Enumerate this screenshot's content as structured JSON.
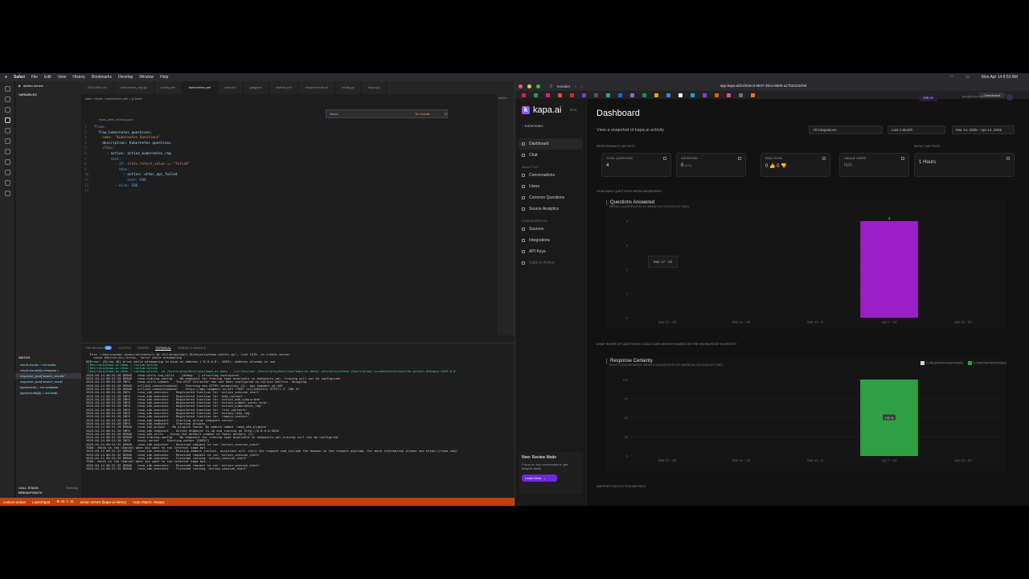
{
  "menubar": {
    "app": "Safari",
    "items": [
      "File",
      "Edit",
      "View",
      "History",
      "Bookmarks",
      "Develop",
      "Window",
      "Help"
    ],
    "clock": "Mon Apr 14 8:53 AM"
  },
  "vscode": {
    "run_config": "action server",
    "variables_header": "VARIABLES",
    "watch_header": "WATCH",
    "watch_items": [
      "result.results = not availa..",
      "result.results[0].metadata =",
      "response_json[\"search_results\"",
      "response_json[\"search_result",
      "type(result) = not available",
      "type(results[0]) = not avail.."
    ],
    "call_stack": "CALL STACK",
    "call_stack_state": "Running",
    "breakpoints": "BREAKPOINTS",
    "tabs": [
      "flows_yaml_schema.json",
      "README.md",
      "kubernetes_rag.py",
      "config.yml",
      "kubernetes.yml",
      "rasa.md",
      "gitignore",
      "shared.yml",
      "requirements.txt",
      "config.py",
      "kapa.py"
    ],
    "active_tab": "kubernetes.yml",
    "breadcrumb": "data > flows > kubernetes.yml > {} flows",
    "schema_hint": "flows_yaml_schema.json",
    "find_query": "Jason",
    "find_result": "No results",
    "code": [
      "flows:",
      "  flow_kubernetes_questions:",
      "    name: \"Kubernetes Questions\"",
      "    description: Kubernetes questions",
      "    steps:",
      "      - action: action_kubernetes_rag",
      "        next:",
      "          - if: slots.return_value == \"failed\"",
      "            then:",
      "              - action: utter_api_failed",
      "                next: END",
      "          - else: END",
      ""
    ],
    "panel_tabs": [
      "PROBLEMS",
      "OUTPUT",
      "PORTS",
      "TERMINAL",
      "DEBUG CONSOLE"
    ],
    "problems_count": "64",
    "active_panel_tab": "TERMINAL",
    "outline_label": "action",
    "terminal": [
      "  File \"/Users/greg/.pyenv/versions/3.10.13/lib/python3.10/asyncio/base_events.py\", line 1519, in create_server",
      "    raise OSError(err.errno, 'error while attempting '",
      "OSError: [Errno 48] error while attempting to bind on address ('0.0.0.0', 5055): address already in use",
      "~/Dev/rasa/kapa-ai-demo | custom-action",
      "~/Dev/rasa/kapa-ai-demo | custom-action",
      "~/Dev/rasa/kapa-ai-demo | custom-action  cd /Users/greg/Dev/rasa/kapa-ai-demo ; /usr/bin/env /Users/greg/Dev/rasa/kapa-ai-demo/.venv/bin/python /Users/greg/.vscode/extensions/ms-python.debugpy-2025.6.0-",
      "2025-04-14 08:51:20 DEBUG   rasa.utils.log_utils  - [debug   ] structlog.configured",
      "2025-04-14 08:51:20 DEBUG   rasa.tracing.config  - No endpoint for tracing type available in endpoints.yml, tracing will not be configured.",
      "2025-04-14 08:51:20 INFO    rasa.utils.common  - The OTLP Collector has not been configured to collect metrics. Skipping.",
      "2025-04-14 08:51:20 DEBUG   urllib3.connectionpool  - Starting new HTTPS connection (1): api.segment.io:443",
      "2025-04-14 08:51:20 DEBUG   urllib3.connectionpool  - https://api.segment.io:443 \"POST /v1/identify HTTP/1.1\" 200 21",
      "2025-04-14 08:51:20 INFO    rasa_sdk.executor  - Registered function for 'action_session_start'.",
      "2025-04-14 08:51:20 INFO    rasa_sdk.executor  - Registered function for 'add_contact'.",
      "2025-04-14 08:51:20 INFO    rasa_sdk.executor  - Registered function for 'action_add_subscriber'.",
      "2025-04-14 08:51:20 INFO    rasa_sdk.executor  - Registered function for 'action_submit_sales_form'.",
      "2025-04-14 08:51:20 INFO    rasa_sdk.executor  - Registered function for 'action_kubernetes_rag'.",
      "2025-04-14 08:51:20 INFO    rasa_sdk.executor  - Registered function for 'list_contacts'.",
      "2025-04-14 08:51:20 INFO    rasa_sdk.executor  - Registered function for 'action_rasa_rag'.",
      "2025-04-14 08:51:20 INFO    rasa_sdk.executor  - Registered function for 'remove_contact'.",
      "2025-04-14 08:51:20 INFO    rasa_sdk.endpoint  - Starting action endpoint server...",
      "2025-04-14 08:51:20 INFO    rasa_sdk.endpoint  - Starting plugins...",
      "2025-04-14 08:51:20 DEBUG   rasa_sdk.plugin  - No plugins found: No module named 'rasa_sdk_plugins'",
      "2025-04-14 08:51:20 INFO    rasa_sdk.endpoint  - Action endpoint is up and running on http://0.0.0.0:5055",
      "2025-04-14 08:51:20 DEBUG   rasa_sdk.utils  - Using the default number of Sanic workers (1).",
      "2025-04-14 08:51:20 DEBUG   rasa.tracing.config  - No endpoint for tracing type available in endpoints.yml,tracing will not be configured.",
      "2025-04-14 08:51:20 INFO    sanic.server  - Starting worker [58557]",
      "2025-04-14 08:51:32 DEBUG   rasa_sdk.executor  - Received request to run 'action_session_start'",
      "TODO: check on the channel when you want to run internal kapa bot...",
      "2025-04-14 08:51:32 DEBUG   rasa_sdk.executor  - Missing domain context, assistant will retry the request and include the domain in the request payload. For more information please see https://rasa.com/",
      "2025-04-14 08:51:32 DEBUG   rasa_sdk.executor  - Received request to run 'action_session_start'",
      "2025-04-14 08:51:32 DEBUG   rasa_sdk.executor  - Finished running 'action_session_start'",
      "TODO: check on the channel when you want to run internal kapa bot...",
      "2025-04-14 08:51:32 DEBUG   rasa_sdk.executor  - Received request to run 'action_session_start'",
      "2025-04-14 08:51:32 DEBUG   rasa_sdk.executor  - Finished running 'action_session_start'"
    ],
    "status": [
      "custom-action",
      "Launchpad",
      "43",
      "11",
      "action server (kapa-ai-demo)",
      "Auto Attach: Always"
    ]
  },
  "browser": {
    "profile": "Snooker",
    "url": "app.kapa.ai/b1f23ecd-5847-4bca-8608-a17b2d13cf6d",
    "active_tab": "Dashboard",
    "fav_colors": [
      "#e11d48",
      "#16a34a",
      "#db2777",
      "#ef4444",
      "#dc2626",
      "#7c3aed",
      "#4b5563",
      "#10b981",
      "#2563eb",
      "#a855f7",
      "#059669",
      "#f59e0b",
      "#3b82f6",
      "#ffffff",
      "#0ea5e9",
      "#9333ea",
      "#ea580c",
      "#ec4899",
      "#6b7280",
      "#f97316"
    ]
  },
  "kapa": {
    "logo": "kapa.ai",
    "beta": "BETA",
    "project": "Kubernetes",
    "nav": [
      {
        "label": "Dashboard",
        "active": true
      },
      {
        "label": "Chat",
        "active": false
      }
    ],
    "analytics_header": "ANALYTICS",
    "analytics": [
      "Conversations",
      "Users",
      "Common Questions",
      "Source Analytics"
    ],
    "config_header": "CONFIGURATION",
    "config": [
      "Sources",
      "Integrations",
      "API Keys",
      "Calls to Action"
    ],
    "promo": {
      "title": "New: Review Mode",
      "text": "Focus on key conversations, get insights faster",
      "button": "Learn More →"
    },
    "ask_ai": "Ask AI",
    "user": "greg@rasa.com",
    "title": "Dashboard",
    "subtitle": "View a snapshot of kapa.ai activity",
    "filter_integrations": "All integrations",
    "filter_range": "Last 1 Month",
    "filter_dates": "Mar 14, 2025 – Apr 14, 2025",
    "perf_label": "PERFORMANCE METRICS",
    "impact_label": "IMPACT METRICS",
    "cards": [
      {
        "label": "TOTAL QUESTIONS",
        "value": "4"
      },
      {
        "label": "UNCERTAIN",
        "value": "0",
        "extra": "(0%)"
      },
      {
        "label": "REACTIONS",
        "value": "0 👍  0 👎"
      },
      {
        "label": "UNIQUE USERS",
        "value": "N/A"
      },
      {
        "label": "",
        "value": "1 Hours"
      }
    ],
    "q1_label": "HOW MANY QUESTIONS WERE ANSWERED?",
    "q2_label": "WHAT SHARE OF QUESTIONS COULD KAPA ANSWER BASED ON THE KNOWLEDGE SOURCES?",
    "q3_label": "SUPPORT DEFLECTION METRICS",
    "tooltip": "Mar 17 - 23",
    "legend": [
      "% UNCERTAIN RESPONSES",
      "% CERTAIN RESPONSES"
    ]
  },
  "chart_data": [
    {
      "type": "bar",
      "title": "Questions Answered",
      "subtitle": "WEEKLY (AGGREGATED BY AMERICA/LOS ANGELES TIME)",
      "categories": [
        "Mar 17 - 23",
        "Mar 24 - 30",
        "Mar 31 - 6",
        "Apr 7 - 13",
        "Apr 14 - 20"
      ],
      "values": [
        0,
        0,
        0,
        4,
        0
      ],
      "yticks": [
        0,
        1,
        2,
        3,
        4
      ],
      "ylim": [
        0,
        4
      ],
      "data_labels": [
        "",
        "",
        "",
        "4",
        ""
      ],
      "colors": [
        "#9b1ec7"
      ]
    },
    {
      "type": "bar",
      "title": "Response Certainty",
      "subtitle": "SHOP TOTAL ANSWERS: WEEKLY (AGGREGATED BY AMERICA/LOS ANGELES TIME)",
      "categories": [
        "Mar 17 - 23",
        "Mar 24 - 30",
        "Mar 31 - 6",
        "Apr 7 - 13",
        "Apr 14 - 20"
      ],
      "series": [
        {
          "name": "% UNCERTAIN RESPONSES",
          "values": [
            0,
            0,
            0,
            0,
            0
          ]
        },
        {
          "name": "% CERTAIN RESPONSES",
          "values": [
            0,
            0,
            0,
            100,
            0
          ]
        }
      ],
      "yticks": [
        0,
        25,
        50,
        75,
        100
      ],
      "ylim": [
        0,
        100
      ],
      "data_labels": [
        "",
        "",
        "",
        "100 %",
        ""
      ],
      "colors": [
        "#9ca3af",
        "#2ea043"
      ]
    }
  ]
}
